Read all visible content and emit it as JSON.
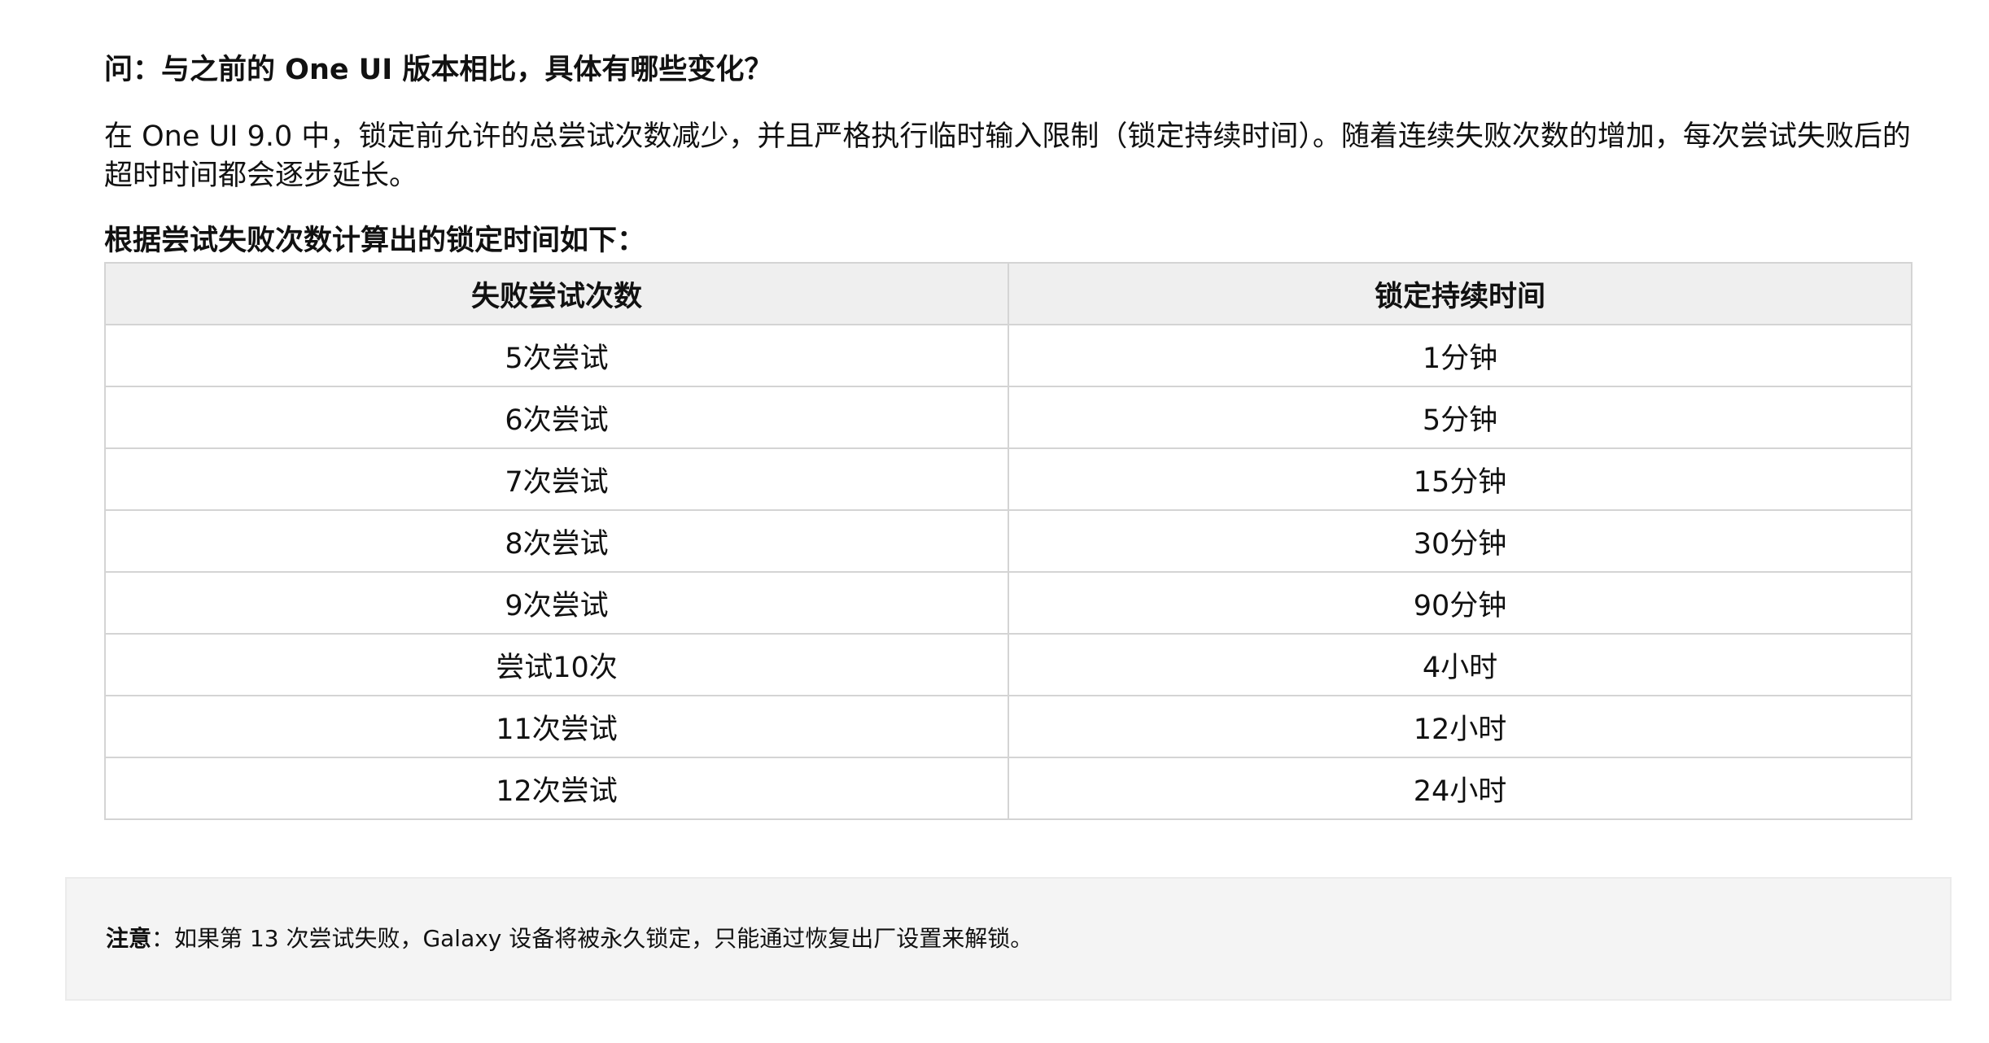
{
  "faq": {
    "question": "问：与之前的 One UI 版本相比，具体有哪些变化？",
    "answer": "在 One UI 9.0 中，锁定前允许的总尝试次数减少，并且严格执行临时输入限制（锁定持续时间）。随着连续失败次数的增加，每次尝试失败后的超时时间都会逐步延长。",
    "table_caption": "根据尝试失败次数计算出的锁定时间如下："
  },
  "table": {
    "headers": [
      "失败尝试次数",
      "锁定持续时间"
    ],
    "rows": [
      [
        "5次尝试",
        "1分钟"
      ],
      [
        "6次尝试",
        "5分钟"
      ],
      [
        "7次尝试",
        "15分钟"
      ],
      [
        "8次尝试",
        "30分钟"
      ],
      [
        "9次尝试",
        "90分钟"
      ],
      [
        "尝试10次",
        "4小时"
      ],
      [
        "11次尝试",
        "12小时"
      ],
      [
        "12次尝试",
        "24小时"
      ]
    ]
  },
  "note": {
    "label": "注意",
    "text": "：如果第 13 次尝试失败，Galaxy 设备将被永久锁定，只能通过恢复出厂设置来解锁。"
  }
}
